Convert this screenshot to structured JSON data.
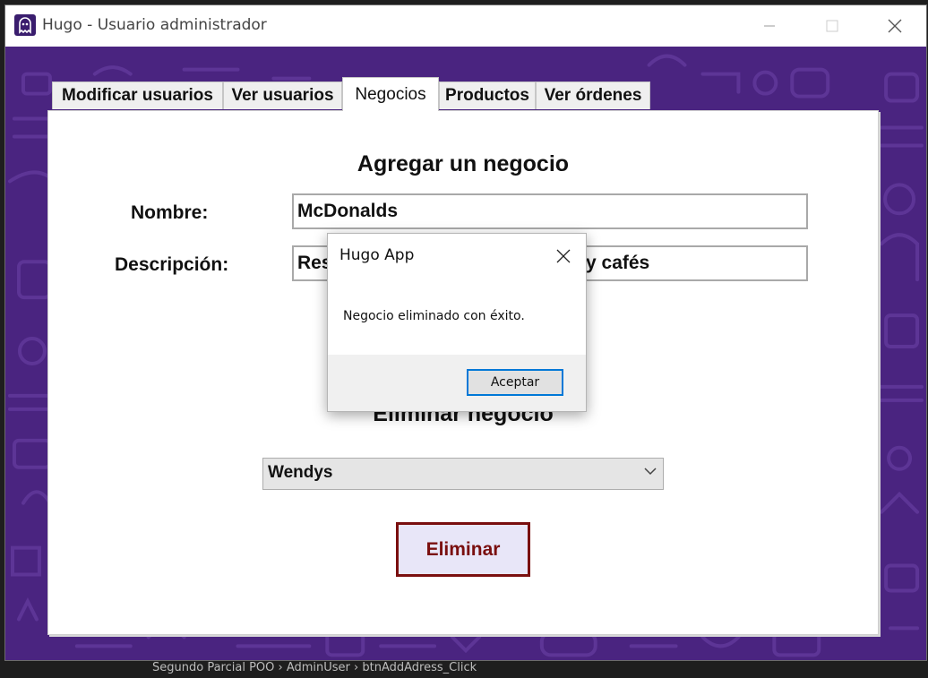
{
  "window": {
    "title": "Hugo - Usuario administrador",
    "accent": "#4a2480"
  },
  "tabs": [
    {
      "label": "Modificar usuarios"
    },
    {
      "label": "Ver usuarios"
    },
    {
      "label": "Negocios",
      "active": true
    },
    {
      "label": "Productos"
    },
    {
      "label": "Ver órdenes"
    }
  ],
  "add_section": {
    "title": "Agregar un negocio",
    "name_label": "Nombre:",
    "name_value": "McDonalds",
    "desc_label": "Descripción:",
    "desc_value_left": "Res",
    "desc_value_right": "y cafés"
  },
  "delete_section": {
    "title": "Eliminar negocio",
    "selected": "Wendys",
    "delete_label": "Eliminar"
  },
  "dialog": {
    "title": "Hugo App",
    "message": "Negocio eliminado con éxito.",
    "ok_label": "Aceptar"
  },
  "background_editor": {
    "breadcrumb": "Segundo Parcial POO  ›  AdminUser  ›  btnAddAdress_Click"
  }
}
